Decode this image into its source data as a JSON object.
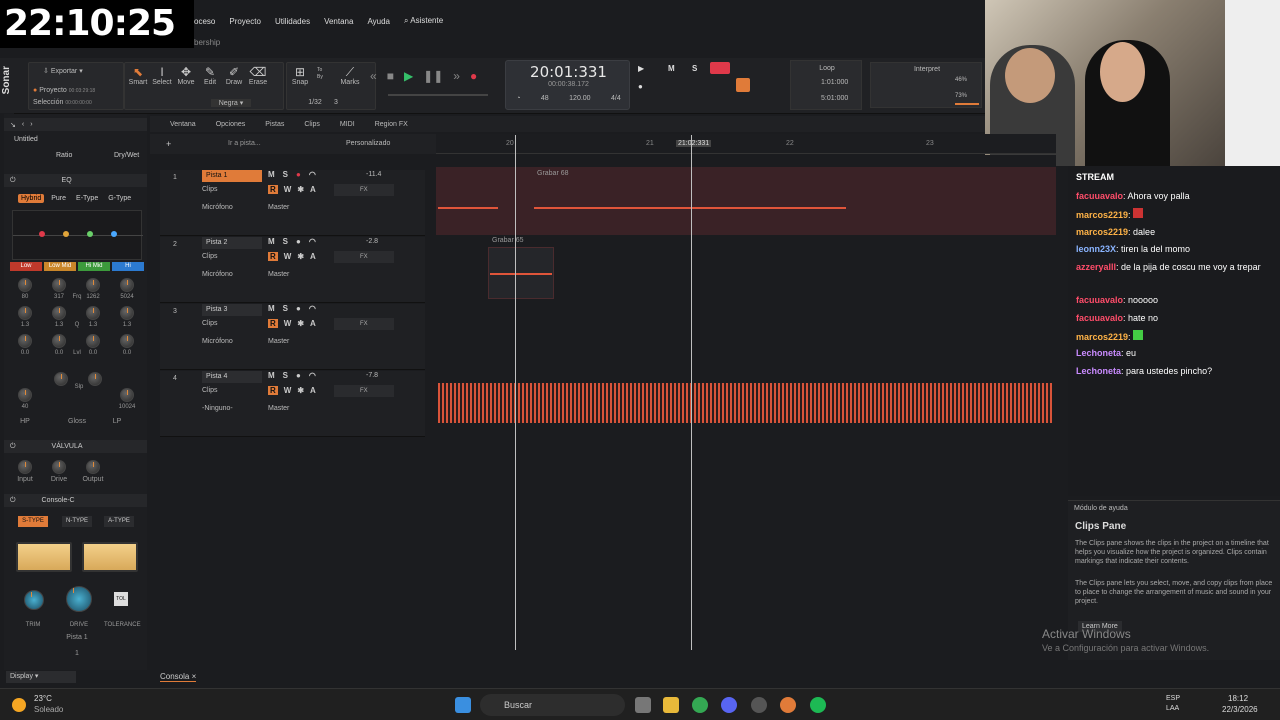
{
  "overlay_clock": "22:10:25",
  "menu": [
    "oceso",
    "Proyecto",
    "Utilidades",
    "Ventana",
    "Ayuda",
    "Asistente"
  ],
  "breadcrumb": "bership",
  "app_name": "Sonar",
  "toolbar": {
    "export": "Exportar",
    "proyecto": "Proyecto",
    "proyecto_time": "00:03:29:18",
    "seleccion": "Selección",
    "seleccion_time": "00:00:00:00",
    "tools": [
      "Smart",
      "Select",
      "Move",
      "Edit",
      "Draw",
      "Erase"
    ],
    "snap": "Snap",
    "marks": "Marks",
    "snap_value": "1/32",
    "snap_num": "3",
    "color": "Negra",
    "snap_to": "To",
    "snap_by": "By"
  },
  "lcd": {
    "time": "20:01:331",
    "sub": "00:00:38.172",
    "tempo": "120.00",
    "sig": "4/4",
    "beat_top": "48",
    "beat_bot": "16"
  },
  "loop": {
    "title": "Loop",
    "start": "1:01:000",
    "end": "5:01:000"
  },
  "interpret": {
    "title": "Interpret",
    "p1": "46%",
    "p2": "73%"
  },
  "msr_labels": {
    "m": "M",
    "s": "S"
  },
  "strip": {
    "name": "Untitled",
    "ratio": "Ratio",
    "drywet": "Dry/Wet",
    "eq_title": "EQ",
    "eq_modes": [
      "Hybrid",
      "Pure",
      "E-Type",
      "G-Type"
    ],
    "bands": [
      "Low",
      "Low Mid",
      "Hi Mid",
      "Hi"
    ],
    "freqs": [
      "80",
      "317",
      "1262",
      "5024"
    ],
    "frq": "Frq",
    "q_vals": [
      "1.3",
      "1.3",
      "1.3",
      "1.3"
    ],
    "q": "Q",
    "gains": [
      "0.0",
      "0.0",
      "0.0",
      "0.0"
    ],
    "lvl": "Lvl",
    "slp": "Slp",
    "hp": "HP",
    "gloss": "Gloss",
    "lp": "LP",
    "hp_val": "40",
    "lp_val": "10024",
    "valvula": "VÁLVULA",
    "v_knobs": [
      "Input",
      "Drive",
      "Output"
    ],
    "console": "Console-C",
    "console_types": [
      "S-TYPE",
      "N-TYPE",
      "A-TYPE"
    ],
    "console_knobs": [
      "TRIM",
      "DRIVE",
      "TOLERANCE"
    ],
    "tol": "TOL",
    "pista": "Pista 1",
    "num": "1",
    "display": "Display"
  },
  "track_menu": [
    "Ventana",
    "Opciones",
    "Pistas",
    "Clips",
    "MIDI",
    "Region FX"
  ],
  "goto": "Ir a pista...",
  "custom": "Personalizado",
  "ruler": [
    "20",
    "21",
    "22",
    "23"
  ],
  "ruler_playhead": "21:02:331",
  "tracks": [
    {
      "num": "1",
      "name": "Pista 1",
      "vol": "-11.4",
      "clips": "Clips",
      "input": "Micrófono",
      "out": "Master",
      "fx": "FX",
      "selected": true
    },
    {
      "num": "2",
      "name": "Pista 2",
      "vol": "-2.8",
      "clips": "Clips",
      "input": "Micrófono",
      "out": "Master",
      "fx": "FX",
      "selected": false
    },
    {
      "num": "3",
      "name": "Pista 3",
      "vol": "",
      "clips": "Clips",
      "input": "Micrófono",
      "out": "Master",
      "fx": "FX",
      "selected": false
    },
    {
      "num": "4",
      "name": "Pista 4",
      "vol": "-7.8",
      "clips": "Clips",
      "input": "-Ninguno-",
      "out": "Master",
      "fx": "FX",
      "selected": false
    }
  ],
  "clip_labels": [
    "Grabar 68",
    "Grabar 65"
  ],
  "console_tab": "Consola",
  "chat": {
    "title": "STREAM",
    "messages": [
      {
        "user": "facuuavalo",
        "text": ": Ahora voy palla",
        "color": "#ff4d6a"
      },
      {
        "user": "marcos2219",
        "text": ":",
        "color": "#ffb347"
      },
      {
        "user": "marcos2219",
        "text": ": dalee",
        "color": "#ffb347"
      },
      {
        "user": "leonn23X",
        "text": ": tiren la del momo",
        "color": "#8ab4ff"
      },
      {
        "user": "azzeryalll",
        "text": ": de la pija de coscu me voy a trepar",
        "color": "#ff4d6a"
      },
      {
        "user": "facuuavalo",
        "text": ": nooooo",
        "color": "#ff4d6a"
      },
      {
        "user": "facuuavalo",
        "text": ": hate no",
        "color": "#ff4d6a"
      },
      {
        "user": "marcos2219",
        "text": ":",
        "color": "#ffb347"
      },
      {
        "user": "Lechoneta",
        "text": ": eu",
        "color": "#c98bff"
      },
      {
        "user": "Lechoneta",
        "text": ": para ustedes pincho?",
        "color": "#c98bff"
      }
    ]
  },
  "help": {
    "title": "Módulo de ayuda",
    "heading": "Clips Pane",
    "p1": "The Clips pane shows the clips in the project on a timeline that helps you visualize how the project is organized. Clips contain markings that indicate their contents.",
    "p2": "The Clips pane lets you select, move, and copy clips from place to place to change the arrangement of music and sound in your project.",
    "learn": "Learn More"
  },
  "watermark": {
    "l1": "Activar Windows",
    "l2": "Ve a Configuración para activar Windows."
  },
  "taskbar": {
    "temp": "23°C",
    "weather": "Soleado",
    "search": "Buscar",
    "lang1": "ESP",
    "lang2": "LAA",
    "time": "18:12",
    "date": "22/3/2026"
  }
}
